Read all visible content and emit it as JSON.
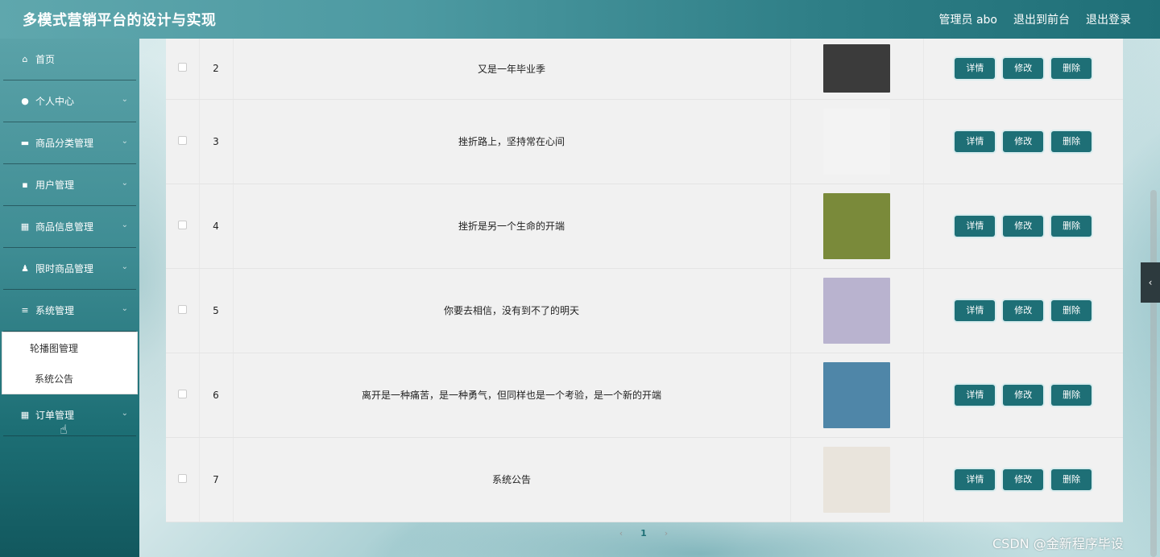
{
  "header": {
    "title": "多模式营销平台的设计与实现",
    "admin_label": "管理员 abo",
    "back_front": "退出到前台",
    "logout": "退出登录"
  },
  "sidebar": {
    "items": [
      {
        "label": "首页",
        "icon": "home-icon"
      },
      {
        "label": "个人中心",
        "icon": "user-icon"
      },
      {
        "label": "商品分类管理",
        "icon": "monitor-icon"
      },
      {
        "label": "用户管理",
        "icon": "printer-icon"
      },
      {
        "label": "商品信息管理",
        "icon": "grid-icon"
      },
      {
        "label": "限时商品管理",
        "icon": "person-icon"
      },
      {
        "label": "系统管理",
        "icon": "list-icon"
      },
      {
        "label": "订单管理",
        "icon": "grid-icon"
      }
    ],
    "submenu": [
      "轮播图管理",
      "系统公告"
    ]
  },
  "buttons": {
    "detail": "详情",
    "edit": "修改",
    "delete": "删除"
  },
  "rows": [
    {
      "index": "2",
      "title": "又是一年毕业季",
      "thumb_color": "#3b3b3b"
    },
    {
      "index": "3",
      "title": "挫折路上，坚持常在心间",
      "thumb_color": "#f3f3f3"
    },
    {
      "index": "4",
      "title": "挫折是另一个生命的开端",
      "thumb_color": "#7a8a3a"
    },
    {
      "index": "5",
      "title": "你要去相信，没有到不了的明天",
      "thumb_color": "#b9b3cf"
    },
    {
      "index": "6",
      "title": "离开是一种痛苦，是一种勇气，但同样也是一个考验，是一个新的开端",
      "thumb_color": "#4f86a8"
    },
    {
      "index": "7",
      "title": "系统公告",
      "thumb_color": "#e9e4dc"
    }
  ],
  "pagination": {
    "prev": "‹",
    "current": "1",
    "next": "›"
  },
  "watermark": "CSDN @金新程序毕设",
  "colors": {
    "accent": "#1e6f76",
    "header": "#3f8f97"
  }
}
